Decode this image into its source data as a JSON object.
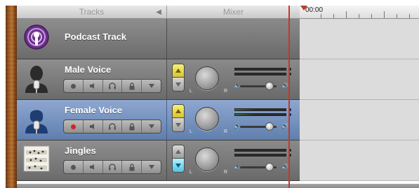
{
  "header": {
    "tracks_label": "Tracks",
    "mixer_label": "Mixer",
    "time": "00:00"
  },
  "tracks": [
    {
      "name": "Podcast Track",
      "icon": "podcast-icon",
      "selected": false
    },
    {
      "name": "Male Voice",
      "icon": "male-voice-icon",
      "selected": false,
      "record_on": false
    },
    {
      "name": "Female Voice",
      "icon": "female-voice-icon",
      "selected": true,
      "record_on": true
    },
    {
      "name": "Jingles",
      "icon": "sheet-music-icon",
      "selected": false,
      "record_on": false
    }
  ],
  "mixer": {
    "pan_left_label": "L",
    "pan_right_label": "R",
    "volume_level": 0.75
  },
  "colors": {
    "selected_track": "#6f8fbf",
    "playhead": "#c0392b",
    "record": "#d62222"
  }
}
